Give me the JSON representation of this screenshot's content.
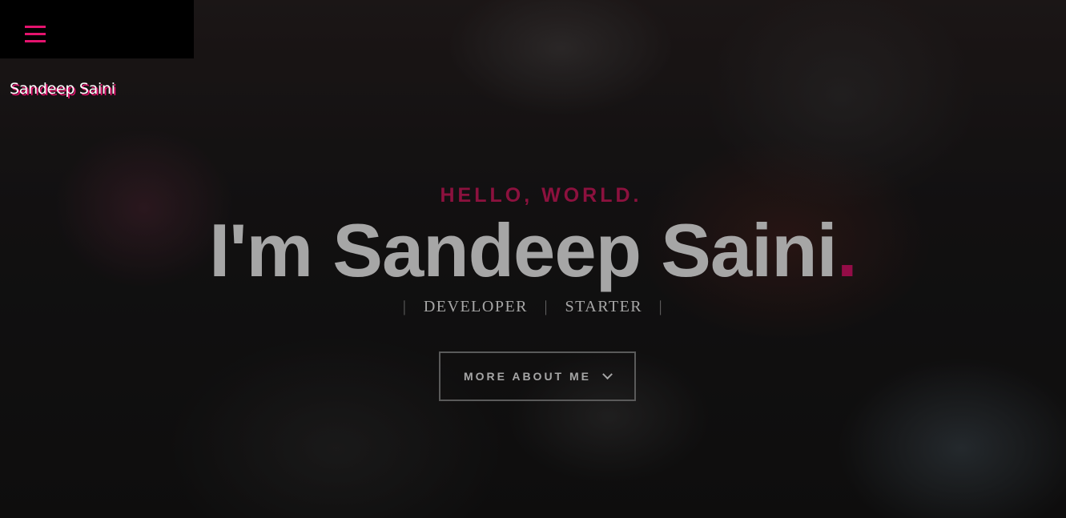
{
  "nav": {
    "menu_icon": "hamburger-menu-icon",
    "logo_text": "Sandeep Saini"
  },
  "hero": {
    "greeting": "HELLO, WORLD.",
    "headline": "I'm Sandeep Saini",
    "headline_dot": ".",
    "roles": [
      "DEVELOPER",
      "STARTER"
    ],
    "separator": "|",
    "cta_label": "MORE ABOUT ME",
    "cta_icon": "chevron-down-icon"
  },
  "colors": {
    "accent": "#e4136e",
    "background": "#1a1818",
    "text": "#ffffff"
  }
}
